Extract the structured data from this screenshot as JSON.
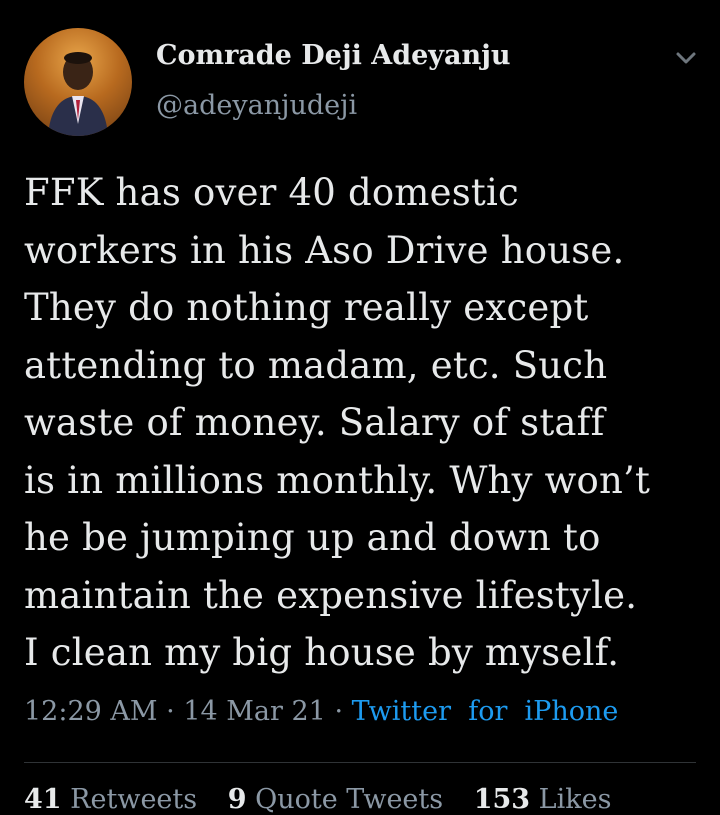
{
  "author": {
    "display_name": "Comrade Deji Adeyanju",
    "handle": "@adeyanjudeji"
  },
  "tweet": {
    "lines": [
      "FFK has over 40 domestic",
      "workers in his Aso Drive house.",
      "They do nothing really except",
      "attending to madam, etc. Such",
      "waste of money. Salary of staff",
      "is in millions monthly. Why won’t",
      "he be jumping up and down to",
      "maintain the expensive lifestyle.",
      "I clean my big house by myself."
    ]
  },
  "meta": {
    "time": "12:29 AM",
    "separator": "·",
    "date": "14 Mar 21",
    "source": "Twitter",
    "source_for": "for",
    "source_device": "iPhone"
  },
  "stats": {
    "retweets_count": "41",
    "retweets_label": "Retweets",
    "quotes_count": "9",
    "quotes_label": "Quote Tweets",
    "likes_count": "153",
    "likes_label": "Likes"
  },
  "icons": {
    "menu": "chevron-down-icon"
  },
  "colors": {
    "background": "#000000",
    "text": "#e7e9ea",
    "secondary": "#8b98a5",
    "link": "#1d9bf0",
    "divider": "#2f3336"
  }
}
